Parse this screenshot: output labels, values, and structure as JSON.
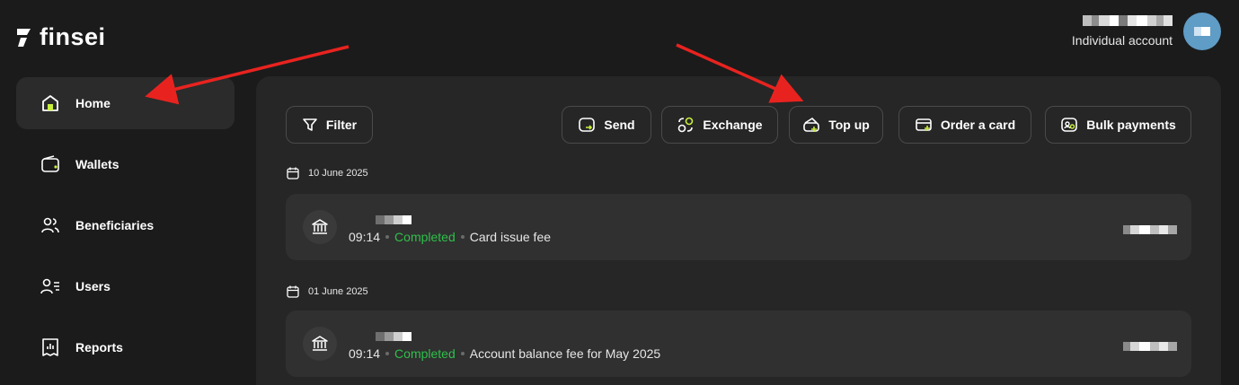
{
  "brand": {
    "name": "finsei"
  },
  "account": {
    "type": "Individual account"
  },
  "sidebar": {
    "items": [
      {
        "label": "Home",
        "icon": "home-icon",
        "active": true
      },
      {
        "label": "Wallets",
        "icon": "wallet-icon"
      },
      {
        "label": "Beneficiaries",
        "icon": "users-icon"
      },
      {
        "label": "Users",
        "icon": "user-list-icon"
      },
      {
        "label": "Reports",
        "icon": "report-icon"
      }
    ]
  },
  "toolbar": {
    "filter_label": "Filter",
    "send_label": "Send",
    "exchange_label": "Exchange",
    "topup_label": "Top up",
    "order_card_label": "Order a card",
    "bulk_label": "Bulk payments"
  },
  "transactions": [
    {
      "date": "10 June 2025",
      "time": "09:14",
      "status": "Completed",
      "description": "Card issue fee",
      "icon": "bank-icon"
    },
    {
      "date": "01 June 2025",
      "time": "09:14",
      "status": "Completed",
      "description": "Account balance fee for May 2025",
      "icon": "bank-icon"
    }
  ],
  "colors": {
    "background": "#1b1b1b",
    "panel": "#262626",
    "card": "#303030",
    "accent_green": "#c8f03c",
    "status_green": "#2fbf4a",
    "annotation_red": "#e8231f",
    "avatar": "#5f9cc6"
  }
}
